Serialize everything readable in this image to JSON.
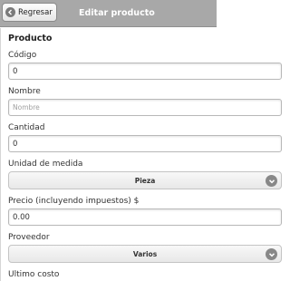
{
  "header": {
    "back_label": "Regresar",
    "title": "Editar producto"
  },
  "form": {
    "section_title": "Producto",
    "codigo": {
      "label": "Código",
      "value": "0"
    },
    "nombre": {
      "label": "Nombre",
      "placeholder": "Nombre"
    },
    "cantidad": {
      "label": "Cantidad",
      "value": "0"
    },
    "unidad": {
      "label": "Unidad de medida",
      "selected": "Pieza"
    },
    "precio": {
      "label": "Precio (incluyendo impuestos) $",
      "value": "0.00"
    },
    "proveedor": {
      "label": "Proveedor",
      "selected": "Varios"
    },
    "ultimo_costo": {
      "label": "Ultimo costo"
    }
  }
}
